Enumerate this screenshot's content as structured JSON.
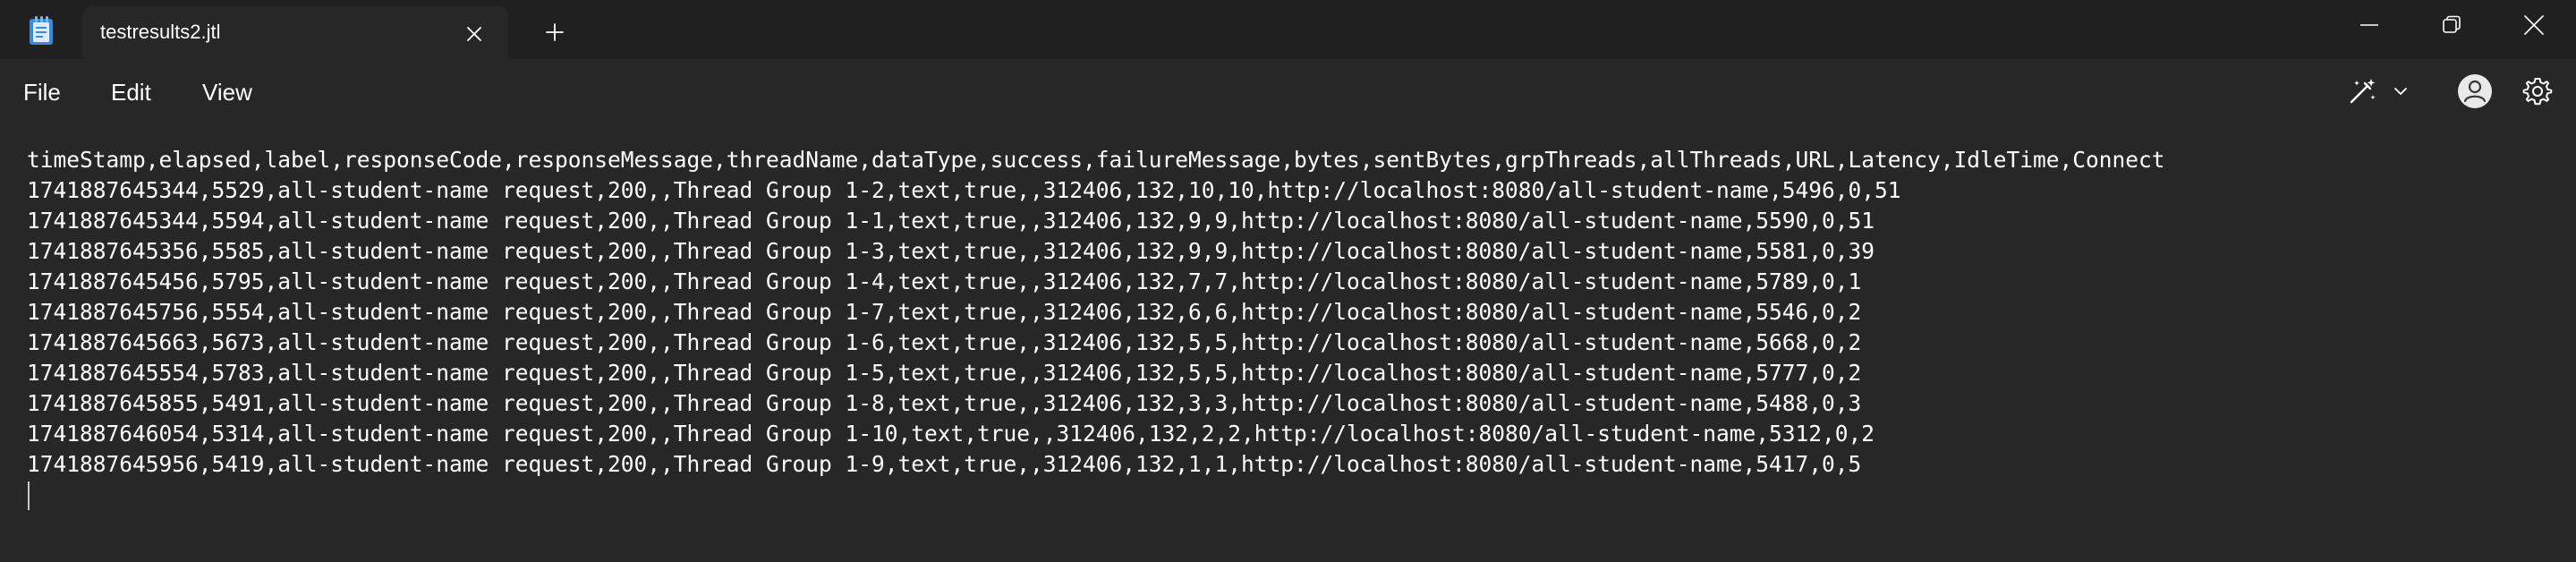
{
  "tab": {
    "title": "testresults2.jtl"
  },
  "menu": {
    "file": "File",
    "edit": "Edit",
    "view": "View"
  },
  "colors": {
    "titlebar_bg": "#202020",
    "editor_bg": "#272727",
    "text": "#ffffff",
    "app_icon_blue": "#3b8ad9"
  },
  "icons": {
    "app": "notepad-icon",
    "close": "close-icon",
    "new_tab": "plus-icon",
    "minimize": "minimize-icon",
    "maximize": "restore-icon",
    "window_close": "close-icon",
    "copilot": "copilot-icon",
    "account": "account-icon",
    "settings": "gear-icon"
  },
  "document": {
    "lines": [
      "timeStamp,elapsed,label,responseCode,responseMessage,threadName,dataType,success,failureMessage,bytes,sentBytes,grpThreads,allThreads,URL,Latency,IdleTime,Connect",
      "1741887645344,5529,all-student-name request,200,,Thread Group 1-2,text,true,,312406,132,10,10,http://localhost:8080/all-student-name,5496,0,51",
      "1741887645344,5594,all-student-name request,200,,Thread Group 1-1,text,true,,312406,132,9,9,http://localhost:8080/all-student-name,5590,0,51",
      "1741887645356,5585,all-student-name request,200,,Thread Group 1-3,text,true,,312406,132,9,9,http://localhost:8080/all-student-name,5581,0,39",
      "1741887645456,5795,all-student-name request,200,,Thread Group 1-4,text,true,,312406,132,7,7,http://localhost:8080/all-student-name,5789,0,1",
      "1741887645756,5554,all-student-name request,200,,Thread Group 1-7,text,true,,312406,132,6,6,http://localhost:8080/all-student-name,5546,0,2",
      "1741887645663,5673,all-student-name request,200,,Thread Group 1-6,text,true,,312406,132,5,5,http://localhost:8080/all-student-name,5668,0,2",
      "1741887645554,5783,all-student-name request,200,,Thread Group 1-5,text,true,,312406,132,5,5,http://localhost:8080/all-student-name,5777,0,2",
      "1741887645855,5491,all-student-name request,200,,Thread Group 1-8,text,true,,312406,132,3,3,http://localhost:8080/all-student-name,5488,0,3",
      "1741887646054,5314,all-student-name request,200,,Thread Group 1-10,text,true,,312406,132,2,2,http://localhost:8080/all-student-name,5312,0,2",
      "1741887645956,5419,all-student-name request,200,,Thread Group 1-9,text,true,,312406,132,1,1,http://localhost:8080/all-student-name,5417,0,5"
    ]
  }
}
